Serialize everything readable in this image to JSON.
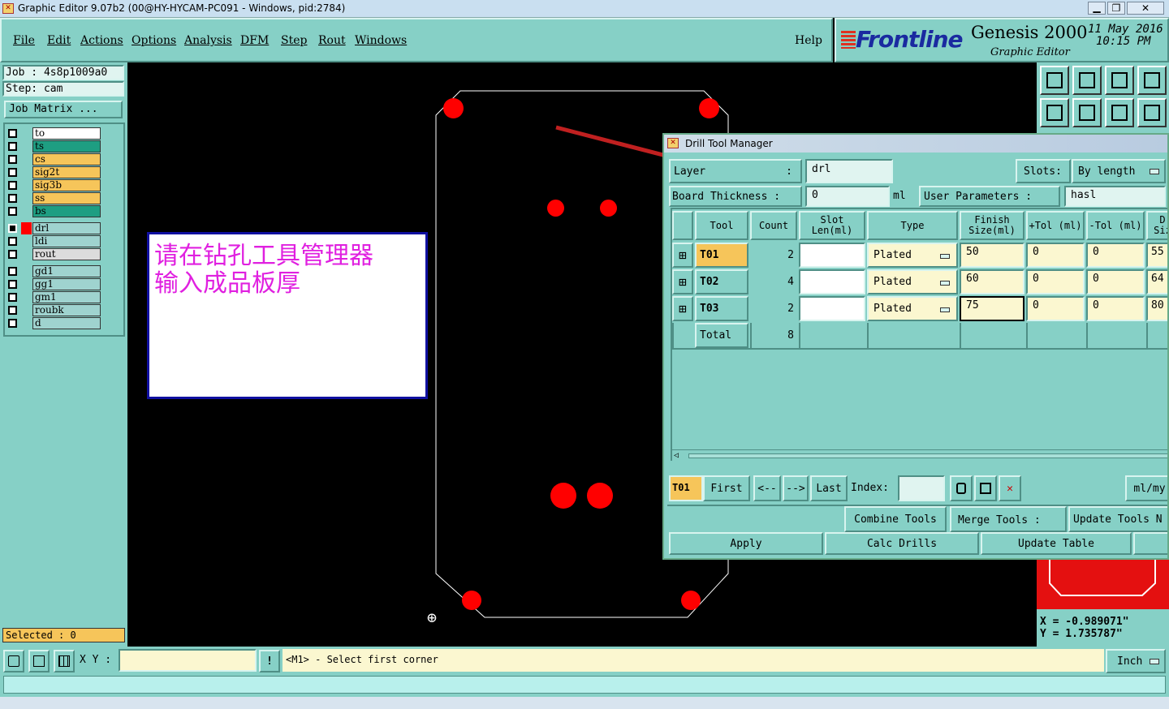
{
  "window_title": "Graphic Editor 9.07b2 (00@HY-HYCAM-PC091 - Windows, pid:2784)",
  "menu": [
    "File",
    "Edit",
    "Actions",
    "Options",
    "Analysis",
    "DFM",
    "Step",
    "Rout",
    "Windows"
  ],
  "help": "Help",
  "brand": {
    "logo": "Frontline",
    "product": "Genesis 2000",
    "subtitle": "Graphic Editor",
    "date": "11 May 2016",
    "time": "10:15 PM"
  },
  "job": {
    "job_label": "Job : 4s8p1009a0",
    "step_label": "Step: cam",
    "job_matrix": "Job Matrix ..."
  },
  "layers": [
    {
      "name": "to",
      "color": "#ffffff"
    },
    {
      "name": "ts",
      "color": "#1e9e82"
    },
    {
      "name": "cs",
      "color": "#f6c55a"
    },
    {
      "name": "sig2t",
      "color": "#f6c55a"
    },
    {
      "name": "sig3b",
      "color": "#f6c55a"
    },
    {
      "name": "ss",
      "color": "#f6c55a"
    },
    {
      "name": "bs",
      "color": "#1e9e82"
    },
    {
      "name": "drl",
      "color": "#9fd3cf"
    },
    {
      "name": "ldi",
      "color": "#9fd3cf"
    },
    {
      "name": "rout",
      "color": "#dcdcdc"
    },
    {
      "name": "gd1",
      "color": "#9fd3cf"
    },
    {
      "name": "gg1",
      "color": "#9fd3cf"
    },
    {
      "name": "gm1",
      "color": "#9fd3cf"
    },
    {
      "name": "roubk",
      "color": "#9fd3cf"
    },
    {
      "name": "d",
      "color": "#9fd3cf"
    }
  ],
  "selected": "Selected : 0",
  "note": {
    "line1": "请在钻孔工具管理器",
    "line2": "输入成品板厚"
  },
  "dtm": {
    "title": "Drill Tool Manager",
    "layer_label": "Layer",
    "layer_value": "drl",
    "slots_label": "Slots:",
    "slots_value": "By length",
    "board_thickness_label": "Board Thickness :",
    "board_thickness_value": "0",
    "board_thickness_unit": "ml",
    "user_params_label": "User Parameters :",
    "user_params_value": "hasl",
    "headers": [
      "Tool",
      "Count",
      "Slot Len(ml)",
      "Type",
      "Finish Size(ml)",
      "+Tol (ml)",
      "-Tol (ml)",
      "D Siz"
    ],
    "rows": [
      {
        "tool": "T01",
        "count": "2",
        "slot": "",
        "type": "Plated",
        "finish": "50",
        "ptol": "0",
        "mtol": "0",
        "dsize": "55"
      },
      {
        "tool": "T02",
        "count": "4",
        "slot": "",
        "type": "Plated",
        "finish": "60",
        "ptol": "0",
        "mtol": "0",
        "dsize": "64"
      },
      {
        "tool": "T03",
        "count": "2",
        "slot": "",
        "type": "Plated",
        "finish": "75",
        "ptol": "0",
        "mtol": "0",
        "dsize": "80"
      }
    ],
    "total_label": "Total",
    "total_count": "8",
    "current_tool": "T01",
    "nav": {
      "first": "First",
      "prev": "<--",
      "next": "-->",
      "last": "Last",
      "index": "Index:",
      "units": "ml/my"
    },
    "combine": "Combine Tools",
    "merge": "Merge Tools :",
    "update_tools": "Update Tools N",
    "apply": "Apply",
    "calc": "Calc Drills",
    "update_table": "Update Table"
  },
  "coords": {
    "x": "X = -0.989071\"",
    "y": "Y = 1.735787\""
  },
  "status": {
    "xy_label": "X Y :",
    "prompt": "<M1> - Select first corner",
    "units": "Inch"
  }
}
